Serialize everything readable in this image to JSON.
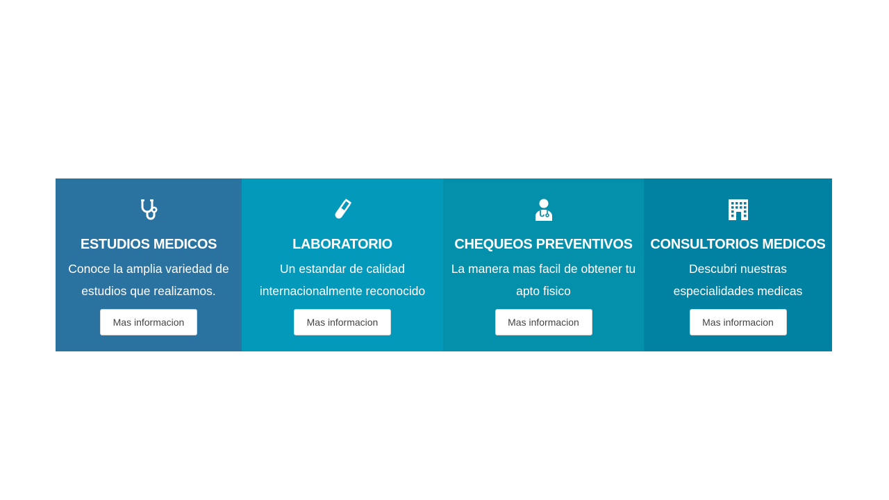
{
  "services": [
    {
      "icon": "stethoscope-icon",
      "title": "ESTUDIOS MEDICOS",
      "description": "Conoce la amplia variedad de estudios que realizamos.",
      "button_label": "Mas informacion"
    },
    {
      "icon": "test-tube-icon",
      "title": "LABORATORIO",
      "description": "Un estandar de calidad internacionalmente reconocido",
      "button_label": "Mas informacion"
    },
    {
      "icon": "doctor-icon",
      "title": "CHEQUEOS PREVENTIVOS",
      "description": "La manera mas facil de obtener tu apto fisico",
      "button_label": "Mas informacion"
    },
    {
      "icon": "hospital-building-icon",
      "title": "CONSULTORIOS MEDICOS",
      "description": "Descubri nuestras especialidades medicas",
      "button_label": "Mas informacion"
    }
  ],
  "colors": {
    "card_1_bg": "#2a72a0",
    "card_2_bg": "#0399ba",
    "card_3_bg": "#0490ab",
    "card_4_bg": "#0282a3",
    "text": "#ffffff",
    "button_bg": "#ffffff",
    "button_text": "#444444"
  }
}
